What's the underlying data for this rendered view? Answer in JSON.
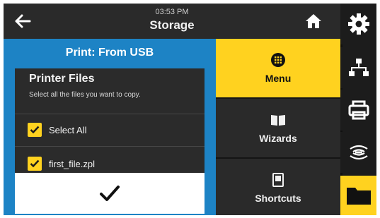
{
  "header": {
    "time": "03:53 PM",
    "title": "Storage"
  },
  "panel": {
    "header": "Print: From USB",
    "title": "Printer Files",
    "instruction": "Select all the files you want to copy.",
    "items": [
      {
        "label": "Select All",
        "checked": true
      },
      {
        "label": "first_file.zpl",
        "checked": true
      }
    ]
  },
  "menu": {
    "items": [
      {
        "label": "Menu",
        "icon": "menu-grid-icon",
        "active": true
      },
      {
        "label": "Wizards",
        "icon": "book-icon",
        "active": false
      },
      {
        "label": "Shortcuts",
        "icon": "bookmark-icon",
        "active": false
      }
    ]
  },
  "sidebar": {
    "items": [
      {
        "icon": "gear-icon",
        "active": false
      },
      {
        "icon": "network-icon",
        "active": false
      },
      {
        "icon": "printer-icon",
        "active": false
      },
      {
        "icon": "wireless-icon",
        "active": false
      },
      {
        "icon": "folder-icon",
        "active": true
      }
    ]
  },
  "colors": {
    "accent": "#ffd21f",
    "blue": "#1d83c5",
    "dark": "#2a2a2a"
  }
}
